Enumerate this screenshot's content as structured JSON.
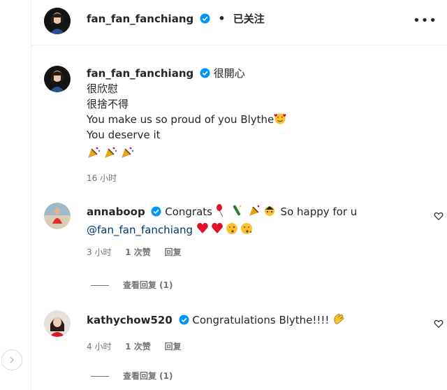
{
  "header": {
    "username": "fan_fan_fanchiang",
    "separator": "•",
    "follow_status": "已关注",
    "more_label": "•••"
  },
  "caption": {
    "username": "fan_fan_fanchiang",
    "lines": [
      "很開心",
      "很欣慰",
      "很捨不得",
      "You make us so proud of you Blythe",
      "You deserve it"
    ],
    "time": "16 小时"
  },
  "comments": [
    {
      "username": "annaboop",
      "text": "Congrats",
      "text2": "So happy for u",
      "mention": "@fan_fan_fanchiang",
      "time": "3 小时",
      "likes": "1 次赞",
      "reply": "回复",
      "view_replies": "查看回复 (1)"
    },
    {
      "username": "kathychow520",
      "text": "Congratulations Blythe!!!!",
      "time": "4 小时",
      "likes": "1 次赞",
      "reply": "回复",
      "view_replies": "查看回复 (1)"
    }
  ],
  "colors": {
    "verified": "#0095f6",
    "meta": "#737373",
    "text": "#262626",
    "heart_red": "#e0112b"
  }
}
